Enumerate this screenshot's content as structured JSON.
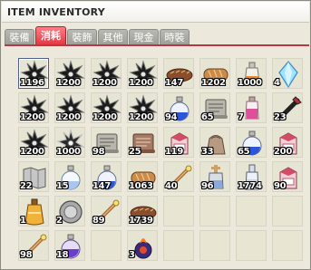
{
  "window": {
    "title": "ITEM INVENTORY"
  },
  "tabs": [
    {
      "label": "裝備",
      "active": false
    },
    {
      "label": "消耗",
      "active": true
    },
    {
      "label": "裝飾",
      "active": false
    },
    {
      "label": "其他",
      "active": false
    },
    {
      "label": "現金",
      "active": false
    },
    {
      "label": "時裝",
      "active": false
    }
  ],
  "colors": {
    "active_tab": "#e2353f",
    "slot_bg": "#e6e4d3"
  },
  "slots": [
    {
      "icon": "throwing-star-icon",
      "qty": "1196",
      "selected": true
    },
    {
      "icon": "throwing-star-icon",
      "qty": "1200"
    },
    {
      "icon": "throwing-star-icon",
      "qty": "1200"
    },
    {
      "icon": "throwing-star-icon",
      "qty": "1200"
    },
    {
      "icon": "bread-icon",
      "qty": "147"
    },
    {
      "icon": "bread-loaf-icon",
      "qty": "1202"
    },
    {
      "icon": "orange-potion-icon",
      "qty": "1000"
    },
    {
      "icon": "blue-crystal-icon",
      "qty": "4"
    },
    {
      "icon": "throwing-star-icon",
      "qty": "1200"
    },
    {
      "icon": "throwing-star-icon",
      "qty": "1200"
    },
    {
      "icon": "throwing-star-icon",
      "qty": "1200"
    },
    {
      "icon": "throwing-star-icon",
      "qty": "1200"
    },
    {
      "icon": "blue-potion-icon",
      "qty": "94"
    },
    {
      "icon": "scroll-icon",
      "qty": "65"
    },
    {
      "icon": "pink-potion-icon",
      "qty": "7"
    },
    {
      "icon": "black-dart-icon",
      "qty": "23"
    },
    {
      "icon": "throwing-star-icon",
      "qty": "1200"
    },
    {
      "icon": "silver-star-icon",
      "qty": "1000"
    },
    {
      "icon": "scroll-icon",
      "qty": "98"
    },
    {
      "icon": "brown-scroll-icon",
      "qty": "25"
    },
    {
      "icon": "milk-carton-icon",
      "qty": "119"
    },
    {
      "icon": "bag-icon",
      "qty": "33"
    },
    {
      "icon": "blue-potion-icon",
      "qty": "65"
    },
    {
      "icon": "milk-carton-icon",
      "qty": "200"
    },
    {
      "icon": "map-scroll-icon",
      "qty": "22"
    },
    {
      "icon": "white-potion-icon",
      "qty": "15"
    },
    {
      "icon": "blue-potion-icon",
      "qty": "147"
    },
    {
      "icon": "bread-loaf-icon",
      "qty": "1063"
    },
    {
      "icon": "wand-icon",
      "qty": "40"
    },
    {
      "icon": "cross-potion-icon",
      "qty": "96"
    },
    {
      "icon": "glass-bottle-icon",
      "qty": "1774"
    },
    {
      "icon": "milk-carton-icon",
      "qty": "90"
    },
    {
      "icon": "golden-flask-icon",
      "qty": "1"
    },
    {
      "icon": "silver-coin-icon",
      "qty": "2"
    },
    {
      "icon": "wand-icon",
      "qty": "89"
    },
    {
      "icon": "bread-icon",
      "qty": "1739"
    },
    {
      "icon": "empty-slot",
      "qty": ""
    },
    {
      "icon": "empty-slot",
      "qty": ""
    },
    {
      "icon": "empty-slot",
      "qty": ""
    },
    {
      "icon": "empty-slot",
      "qty": ""
    },
    {
      "icon": "wand-icon",
      "qty": "98"
    },
    {
      "icon": "purple-potion-icon",
      "qty": "18"
    },
    {
      "icon": "empty-slot",
      "qty": ""
    },
    {
      "icon": "fire-orb-icon",
      "qty": "3"
    },
    {
      "icon": "empty-slot",
      "qty": ""
    },
    {
      "icon": "empty-slot",
      "qty": ""
    },
    {
      "icon": "empty-slot",
      "qty": ""
    },
    {
      "icon": "empty-slot",
      "qty": ""
    }
  ]
}
